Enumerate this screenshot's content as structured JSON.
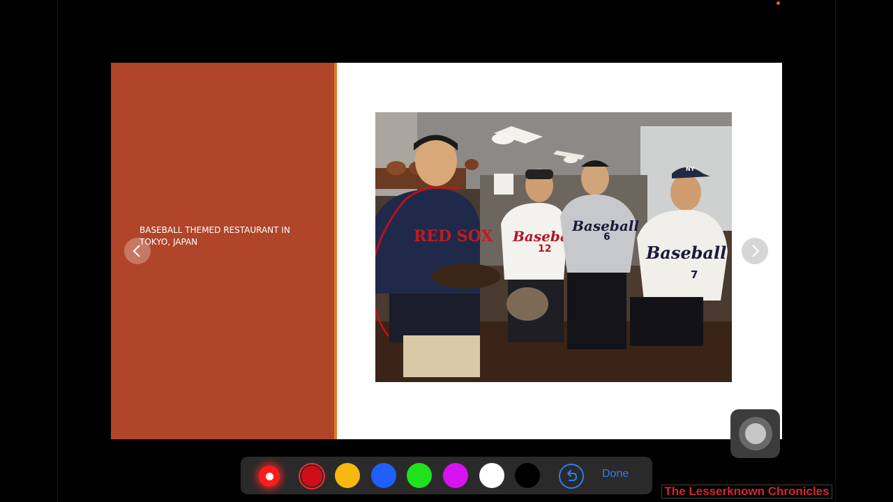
{
  "slide": {
    "caption": "BASEBALL THEMED RESTAURANT IN TOKYO, JAPAN",
    "left_panel_color": "#b0452a",
    "stripe_color": "#e07b25",
    "photo": {
      "description_icon": "photo-image",
      "jersey_texts": [
        "RED SOX",
        "Baseball",
        "Baseball",
        "Baseball"
      ],
      "jersey_numbers": [
        "12",
        "6",
        "7"
      ],
      "cap_logo": "NY"
    }
  },
  "navigation": {
    "prev_icon": "chevron-left-icon",
    "next_icon": "chevron-right-icon"
  },
  "toolbar": {
    "tools": [
      {
        "name": "laser-pointer",
        "color": "#ff1a1a",
        "selected": false
      },
      {
        "name": "red",
        "color": "#d00d17",
        "selected": true
      },
      {
        "name": "yellow",
        "color": "#f7b80f"
      },
      {
        "name": "blue",
        "color": "#1f5ffa"
      },
      {
        "name": "green",
        "color": "#20e21c"
      },
      {
        "name": "purple",
        "color": "#d712f0"
      },
      {
        "name": "white",
        "color": "#ffffff"
      },
      {
        "name": "black",
        "color": "#000000"
      }
    ],
    "undo_icon": "undo-icon",
    "done_label": "Done"
  },
  "watermark": {
    "text": "The Lesserknown Chronicles"
  }
}
